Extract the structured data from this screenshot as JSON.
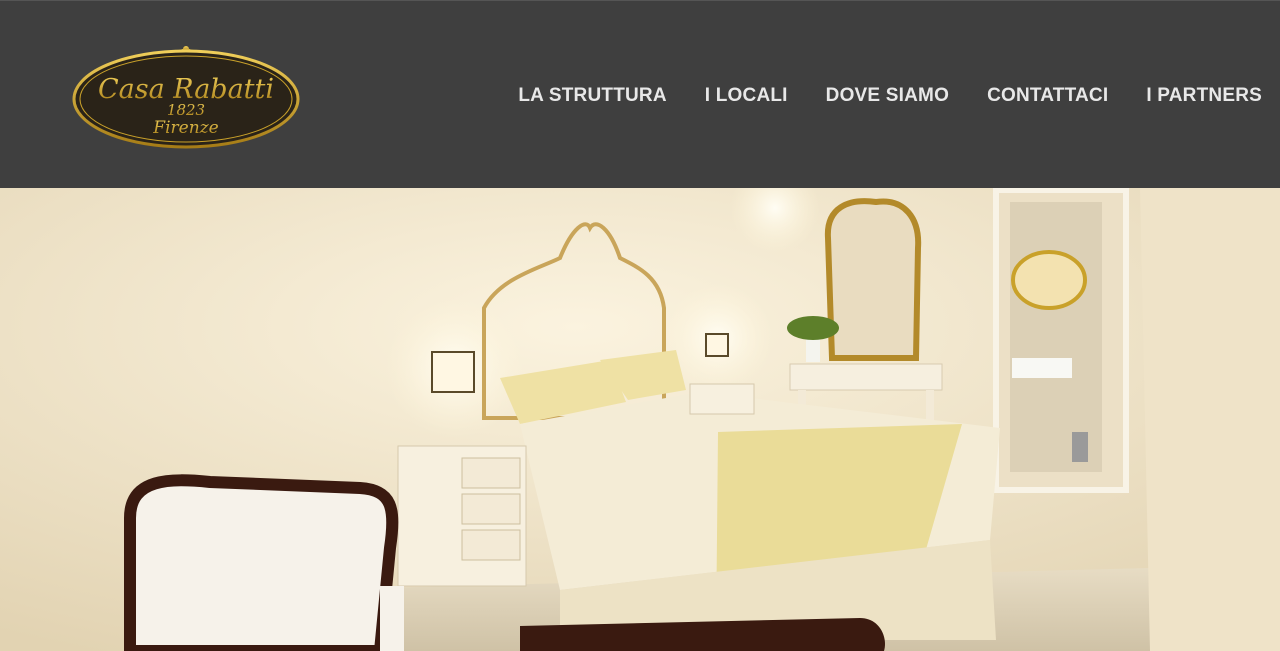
{
  "brand": {
    "logo_text": "Casa Rabatti",
    "logo_year": "1823",
    "logo_city": "Firenze"
  },
  "nav": {
    "items": [
      {
        "label": "LA STRUTTURA"
      },
      {
        "label": "I LOCALI"
      },
      {
        "label": "DOVE SIAMO"
      },
      {
        "label": "CONTATTACI"
      },
      {
        "label": "I PARTNERS"
      }
    ]
  },
  "colors": {
    "header_bg": "#3f3f3f",
    "nav_text": "#e8e8e8",
    "logo_gold": "#c9a12a",
    "logo_dark": "#2a2318"
  },
  "hero": {
    "image_subject": "bedroom-photo"
  }
}
